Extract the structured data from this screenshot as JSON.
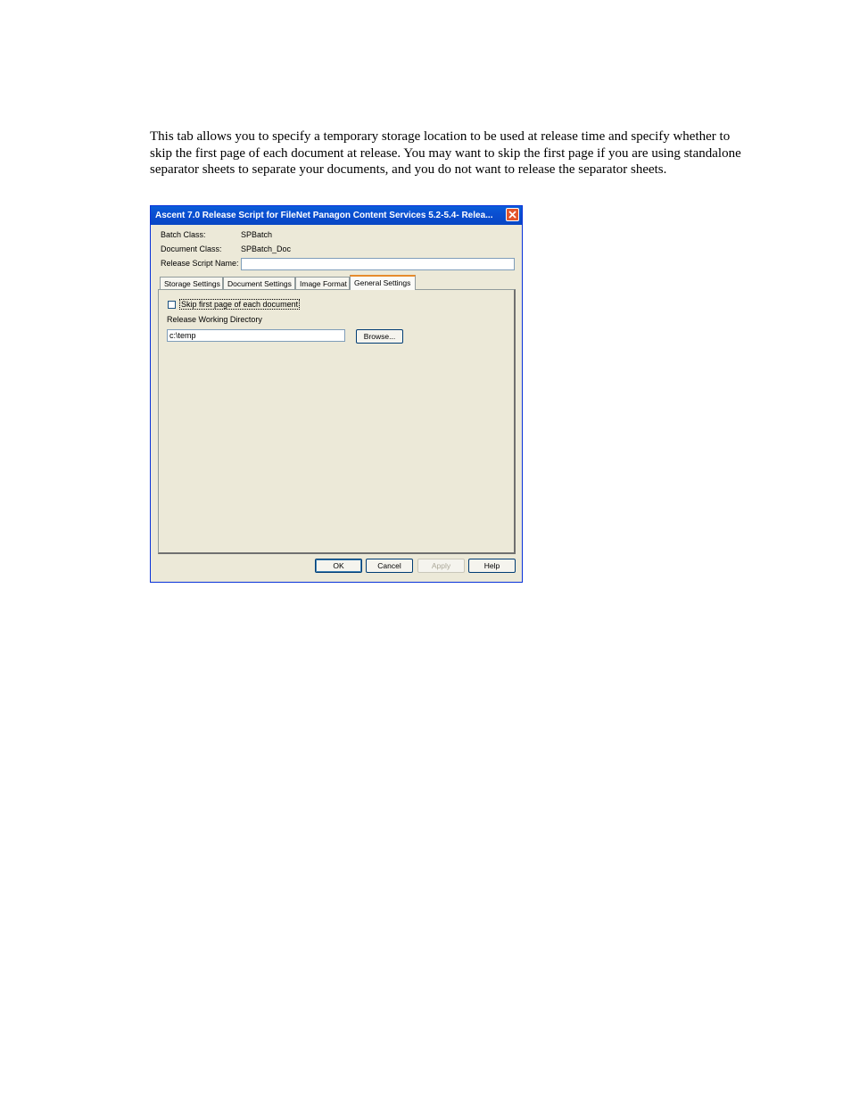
{
  "intro_text": "This tab allows you to specify a temporary storage location to be used at release time and specify whether to skip the first page of each document at release. You may want to skip the first page if you are using standalone separator sheets to separate your documents, and you do not want to release the separator sheets.",
  "dialog": {
    "title": "Ascent 7.0 Release Script for FileNet Panagon Content Services 5.2-5.4- Relea...",
    "fields": {
      "batch_class_label": "Batch Class:",
      "batch_class_value": "SPBatch",
      "document_class_label": "Document Class:",
      "document_class_value": "SPBatch_Doc",
      "release_script_name_label": "Release Script Name:",
      "release_script_name_value": ""
    },
    "tabs": [
      {
        "label": "Storage Settings"
      },
      {
        "label": "Document Settings"
      },
      {
        "label": "Image Format"
      },
      {
        "label": "General Settings",
        "active": true
      }
    ],
    "general": {
      "skip_first_page_label": "Skip first page of each document",
      "skip_first_page_checked": false,
      "working_dir_label": "Release Working Directory",
      "working_dir_value": "c:\\temp",
      "browse_label": "Browse..."
    },
    "buttons": {
      "ok": "OK",
      "cancel": "Cancel",
      "apply": "Apply",
      "help": "Help"
    }
  },
  "colors": {
    "dialog_bg": "#ece9d8",
    "title_bar": "#0a4fd1",
    "close_button": "#e2552d"
  }
}
